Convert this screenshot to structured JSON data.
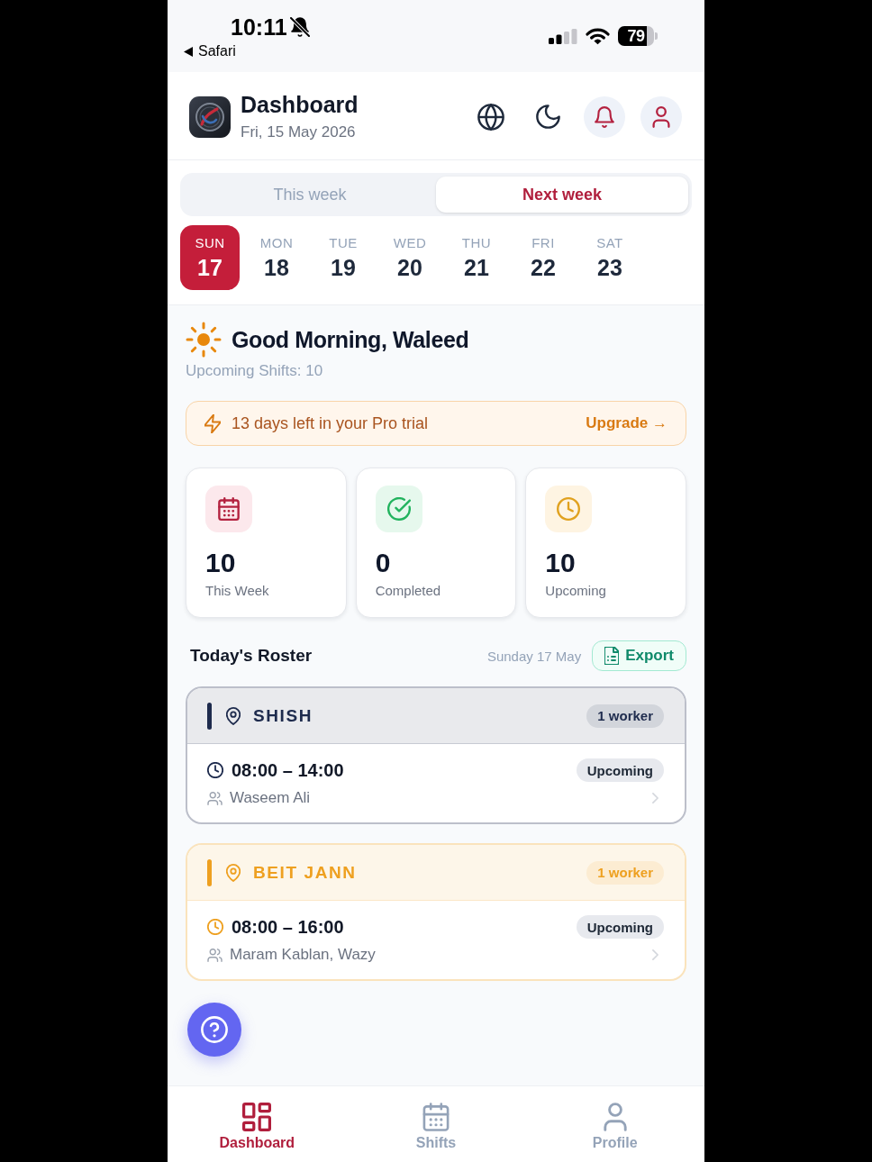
{
  "status_bar": {
    "time": "10:11",
    "back_label": "Safari",
    "battery": "79"
  },
  "header": {
    "title": "Dashboard",
    "date": "Fri, 15 May 2026"
  },
  "week_tabs": [
    {
      "label": "This week",
      "selected": false
    },
    {
      "label": "Next week",
      "selected": true
    }
  ],
  "days": [
    {
      "weekday": "SUN",
      "date": "17",
      "selected": true
    },
    {
      "weekday": "MON",
      "date": "18",
      "selected": false
    },
    {
      "weekday": "TUE",
      "date": "19",
      "selected": false
    },
    {
      "weekday": "WED",
      "date": "20",
      "selected": false
    },
    {
      "weekday": "THU",
      "date": "21",
      "selected": false
    },
    {
      "weekday": "FRI",
      "date": "22",
      "selected": false
    },
    {
      "weekday": "SAT",
      "date": "23",
      "selected": false
    }
  ],
  "greeting": {
    "title": "Good Morning, Waleed",
    "subtitle": "Upcoming Shifts: 10"
  },
  "trial_banner": {
    "message": "13 days left in your Pro trial",
    "action": "Upgrade →"
  },
  "stats": [
    {
      "kind": "week",
      "value": "10",
      "label": "This Week"
    },
    {
      "kind": "completed",
      "value": "0",
      "label": "Completed"
    },
    {
      "kind": "upcoming",
      "value": "10",
      "label": "Upcoming"
    }
  ],
  "roster": {
    "title": "Today's Roster",
    "date": "Sunday 17 May",
    "export_label": "Export",
    "locations": [
      {
        "name": "SHISH",
        "workers_count": "1 worker",
        "color": "#1e2b4d",
        "shifts": [
          {
            "time": "08:00 – 14:00",
            "status": "Upcoming",
            "workers": "Waseem Ali"
          }
        ]
      },
      {
        "name": "BEIT JANN",
        "workers_count": "1 worker",
        "color": "#eea020",
        "shifts": [
          {
            "time": "08:00 – 16:00",
            "status": "Upcoming",
            "workers": "Maram Kablan, Wazy"
          }
        ]
      }
    ]
  },
  "bottom_nav": [
    {
      "kind": "dashboard",
      "label": "Dashboard",
      "selected": true
    },
    {
      "kind": "shifts",
      "label": "Shifts",
      "selected": false
    },
    {
      "kind": "profile",
      "label": "Profile",
      "selected": false
    }
  ]
}
